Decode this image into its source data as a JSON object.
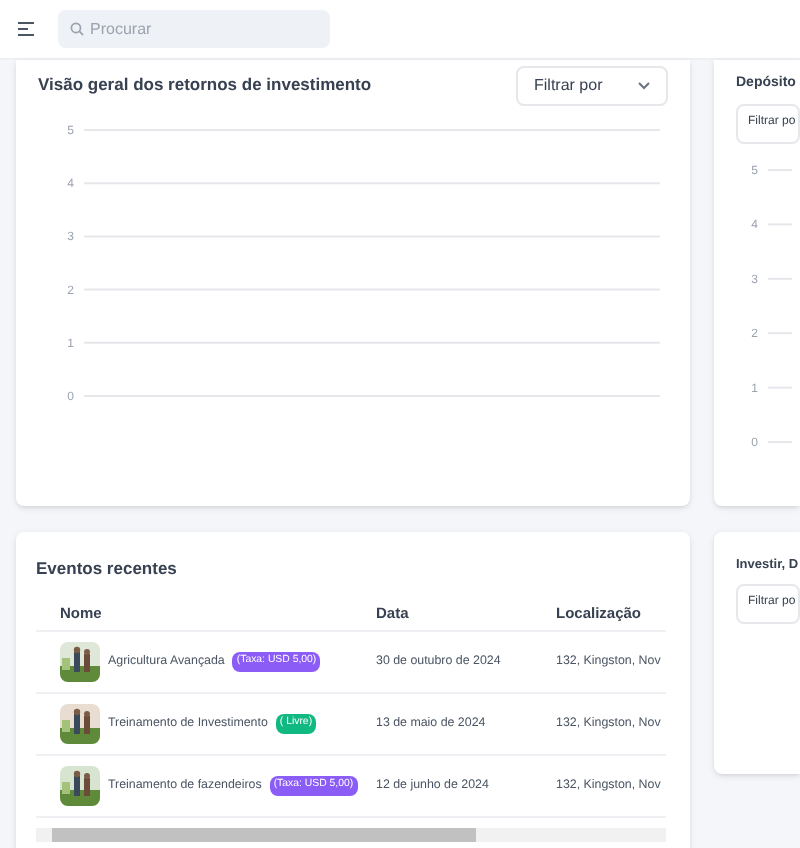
{
  "header": {
    "search": {
      "placeholder": "Procurar"
    }
  },
  "roi_card": {
    "title": "Visão geral dos retornos de investimento",
    "filter": "Filtrar por",
    "axis_labels": [
      "5",
      "4",
      "3",
      "2",
      "1",
      "0"
    ]
  },
  "deposit_card": {
    "title": "Depósito",
    "filter": "Filtrar po",
    "axis_labels": [
      "5",
      "4",
      "3",
      "2",
      "1",
      "0"
    ]
  },
  "events_card": {
    "title": "Eventos recentes",
    "columns": [
      "Nome",
      "Data",
      "Localização"
    ],
    "rows": [
      {
        "name": "Agricultura Avançada",
        "badge": "(Taxa: USD 5,00)",
        "color": "#8b5cf6",
        "date": "30 de outubro de 2024",
        "location": "132, Kingston, Nov"
      },
      {
        "name": "Treinamento de Investimento",
        "badge": "( Livre)",
        "color": "#10b981",
        "date": "13 de maio de 2024",
        "location": "132, Kingston, Nov"
      },
      {
        "name": "Treinamento de fazendeiros",
        "badge": "(Taxa: USD 5,00)",
        "color": "#8b5cf6",
        "date": "12 de junho de 2024",
        "location": "132, Kingston, Nov"
      }
    ]
  },
  "invest_card": {
    "title": "Investir, D",
    "filter": "Filtrar po"
  }
}
